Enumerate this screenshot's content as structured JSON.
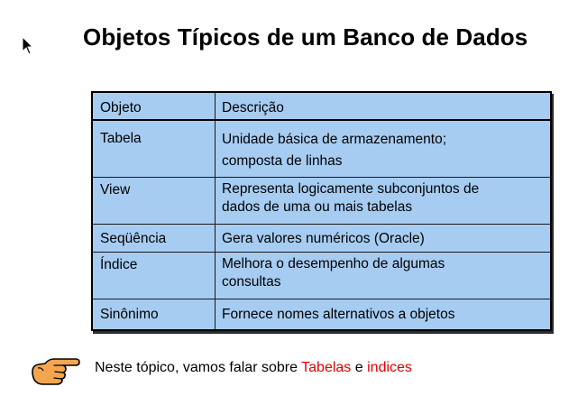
{
  "title": "Objetos Típicos de um Banco de Dados",
  "table": {
    "headers": {
      "object": "Objeto",
      "description": "Descrição"
    },
    "rows": [
      {
        "object": "Tabela",
        "description": [
          "Unidade básica de armazenamento;",
          "composta de linhas"
        ]
      },
      {
        "object": "View",
        "description": [
          "Representa logicamente subconjuntos de",
          "dados de uma ou mais tabelas"
        ]
      },
      {
        "object": "Seqüência",
        "description": [
          "Gera valores numéricos (Oracle)"
        ]
      },
      {
        "object": "Índice",
        "description": [
          "Melhora o desempenho de algumas",
          "consultas"
        ]
      },
      {
        "object": "Sinônimo",
        "description": [
          "Fornece nomes alternativos a objetos"
        ]
      }
    ]
  },
  "footer": {
    "prefix": "Neste tópico, vamos falar sobre ",
    "highlight1": "Tabelas",
    "middle": " e ",
    "highlight2": "indices",
    "highlight_color": "#e00000"
  },
  "icons": {
    "cursor": "arrow-cursor-icon",
    "bullet": "pointing-hand-icon"
  },
  "colors": {
    "table_background": "#a6ccf2"
  }
}
